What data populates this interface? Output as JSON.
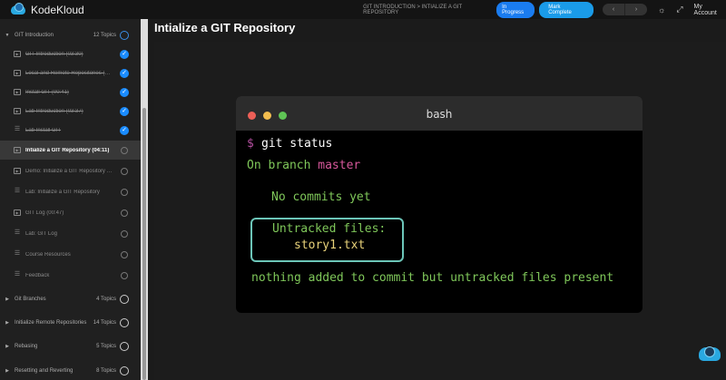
{
  "header": {
    "brand": "KodeKloud",
    "breadcrumb": "GIT INTRODUCTION > INTIALIZE A GIT REPOSITORY",
    "status": "In Progress",
    "mark_complete": "Mark Complete",
    "prev": "‹",
    "next": "›",
    "theme_icon": "☼",
    "expand_icon": "⤢",
    "account": "My Account",
    "colors": {
      "status": "#1a7cf0",
      "mark": "#1a9be8"
    }
  },
  "sidebar": {
    "sections": [
      {
        "title": "GIT Introduction",
        "count": "12 Topics",
        "expanded": true
      }
    ],
    "items": [
      {
        "label": "GIT Introduction (03:30)",
        "type": "video",
        "done": true
      },
      {
        "label": "Local and Remote Repositories (01:...",
        "type": "video",
        "done": true
      },
      {
        "label": "Install GIT (00:41)",
        "type": "video",
        "done": true
      },
      {
        "label": "Lab Introduction (03:37)",
        "type": "video",
        "done": true
      },
      {
        "label": "Lab Install GIT",
        "type": "lab",
        "done": true
      },
      {
        "label": "Intialize a GIT Repository (04:11)",
        "type": "video",
        "done": false,
        "active": true
      },
      {
        "label": "Demo: Initialize a GIT Repository (1...",
        "type": "video",
        "done": false
      },
      {
        "label": "Lab: Initialize a GIT Repository",
        "type": "lab",
        "done": false
      },
      {
        "label": "GIT Log (00:47)",
        "type": "video",
        "done": false
      },
      {
        "label": "Lab: GIT Log",
        "type": "lab",
        "done": false
      },
      {
        "label": "Course Resources",
        "type": "lab",
        "done": false
      },
      {
        "label": "Feedback",
        "type": "lab",
        "done": false
      }
    ],
    "more_sections": [
      {
        "title": "Git Branches",
        "count": "4 Topics"
      },
      {
        "title": "Initialize Remote Repositories",
        "count": "14 Topics"
      },
      {
        "title": "Rebasing",
        "count": "5 Topics"
      },
      {
        "title": "Resetting and Reverting",
        "count": "8 Topics"
      }
    ]
  },
  "main": {
    "title": "Intialize a GIT Repository"
  },
  "terminal": {
    "name": "bash",
    "prompt": "$",
    "command": "git status",
    "line1a": "On branch ",
    "line1b": "master",
    "line2": "No commits yet",
    "untracked": "Untracked files:",
    "file": "story1.txt",
    "footer": "nothing added to commit but untracked files present"
  }
}
